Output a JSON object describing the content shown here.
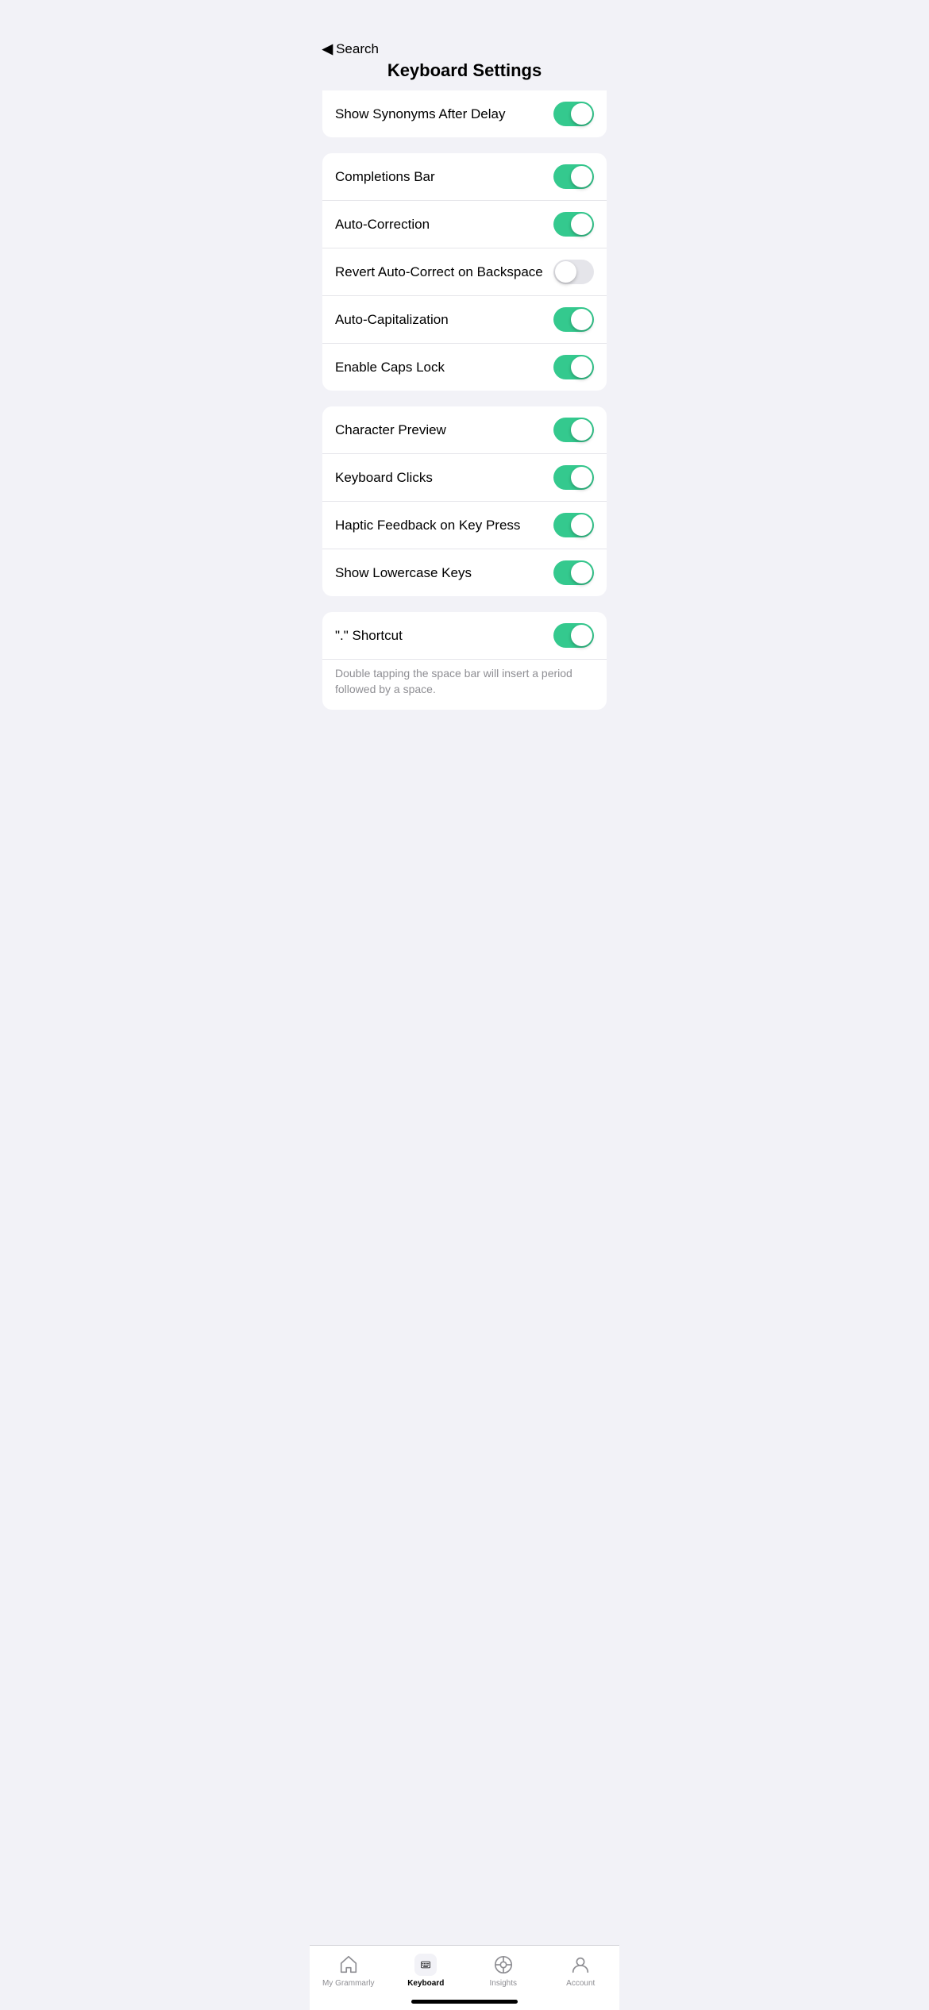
{
  "header": {
    "back_label": "Search",
    "title": "Keyboard Settings"
  },
  "sections": [
    {
      "id": "section-top-partial",
      "items": [
        {
          "id": "show-synonyms",
          "label": "Show Synonyms After Delay",
          "toggle_on": true
        }
      ]
    },
    {
      "id": "section-corrections",
      "items": [
        {
          "id": "completions-bar",
          "label": "Completions Bar",
          "toggle_on": true
        },
        {
          "id": "auto-correction",
          "label": "Auto-Correction",
          "toggle_on": true
        },
        {
          "id": "revert-auto-correct",
          "label": "Revert Auto-Correct on Backspace",
          "toggle_on": false
        },
        {
          "id": "auto-capitalization",
          "label": "Auto-Capitalization",
          "toggle_on": true
        },
        {
          "id": "enable-caps-lock",
          "label": "Enable Caps Lock",
          "toggle_on": true
        }
      ]
    },
    {
      "id": "section-feedback",
      "items": [
        {
          "id": "character-preview",
          "label": "Character Preview",
          "toggle_on": true
        },
        {
          "id": "keyboard-clicks",
          "label": "Keyboard Clicks",
          "toggle_on": true
        },
        {
          "id": "haptic-feedback",
          "label": "Haptic Feedback on Key Press",
          "toggle_on": true
        },
        {
          "id": "show-lowercase-keys",
          "label": "Show Lowercase Keys",
          "toggle_on": true
        }
      ]
    },
    {
      "id": "section-shortcut",
      "items": [
        {
          "id": "period-shortcut",
          "label": "“.” Shortcut",
          "toggle_on": true
        }
      ],
      "hint": "Double tapping the space bar will insert a period followed by a space."
    }
  ],
  "tabs": [
    {
      "id": "my-grammarly",
      "label": "My Grammarly",
      "active": false,
      "icon": "home-icon"
    },
    {
      "id": "keyboard",
      "label": "Keyboard",
      "active": true,
      "icon": "keyboard-icon"
    },
    {
      "id": "insights",
      "label": "Insights",
      "active": false,
      "icon": "insights-icon"
    },
    {
      "id": "account",
      "label": "Account",
      "active": false,
      "icon": "account-icon"
    }
  ]
}
